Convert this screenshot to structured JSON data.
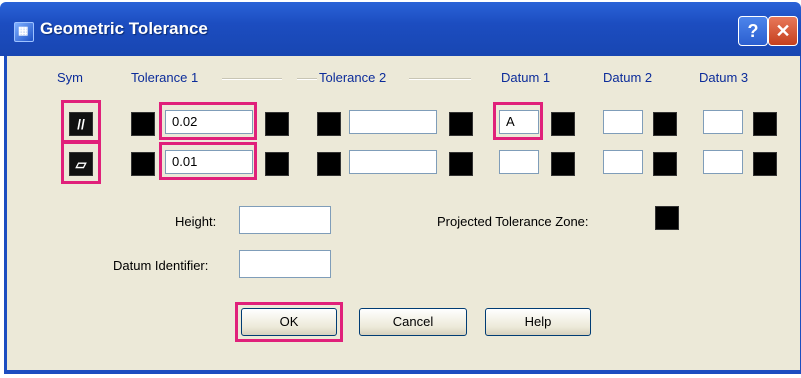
{
  "window": {
    "title": "Geometric Tolerance",
    "help_label": "?",
    "close_label": "✕"
  },
  "headers": {
    "sym": "Sym",
    "tol1": "Tolerance 1",
    "tol2": "Tolerance 2",
    "datum1": "Datum 1",
    "datum2": "Datum 2",
    "datum3": "Datum 3"
  },
  "rows": [
    {
      "symbol_icon": "parallelism-icon",
      "tol1_value": "0.02",
      "tol2_value": "",
      "datum1_value": "A",
      "datum2_value": "",
      "datum3_value": ""
    },
    {
      "symbol_icon": "flatness-icon",
      "tol1_value": "0.01",
      "tol2_value": "",
      "datum1_value": "",
      "datum2_value": "",
      "datum3_value": ""
    }
  ],
  "height_label": "Height:",
  "height_value": "",
  "datum_identifier_label": "Datum Identifier:",
  "datum_identifier_value": "",
  "projected_label": "Projected Tolerance Zone:",
  "buttons": {
    "ok": "OK",
    "cancel": "Cancel",
    "help": "Help"
  },
  "highlight_color": "#e0207a"
}
